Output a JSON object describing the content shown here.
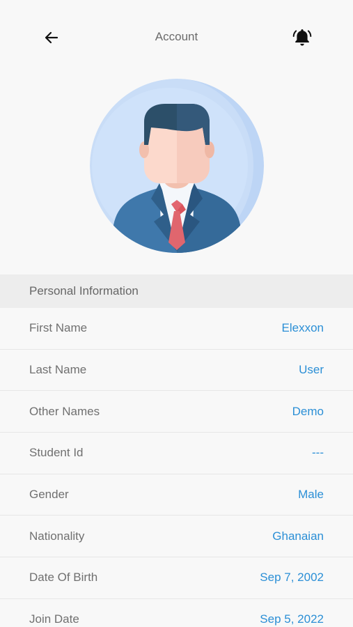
{
  "header": {
    "title": "Account",
    "back_icon": "arrow-left-icon",
    "notification_icon": "bell-ringing-icon"
  },
  "avatar": {
    "icon": "businessman-avatar"
  },
  "section": {
    "title": "Personal Information"
  },
  "fields": [
    {
      "label": "First Name",
      "value": "Elexxon"
    },
    {
      "label": "Last Name",
      "value": "User"
    },
    {
      "label": "Other Names",
      "value": "Demo"
    },
    {
      "label": "Student Id",
      "value": "---"
    },
    {
      "label": "Gender",
      "value": "Male"
    },
    {
      "label": "Nationality",
      "value": "Ghanaian"
    },
    {
      "label": "Date Of Birth",
      "value": "Sep 7, 2002"
    },
    {
      "label": "Join Date",
      "value": "Sep 5, 2022"
    }
  ],
  "colors": {
    "accent": "#2b8fd6",
    "background": "#f8f8f8",
    "section_bg": "#ededed"
  }
}
